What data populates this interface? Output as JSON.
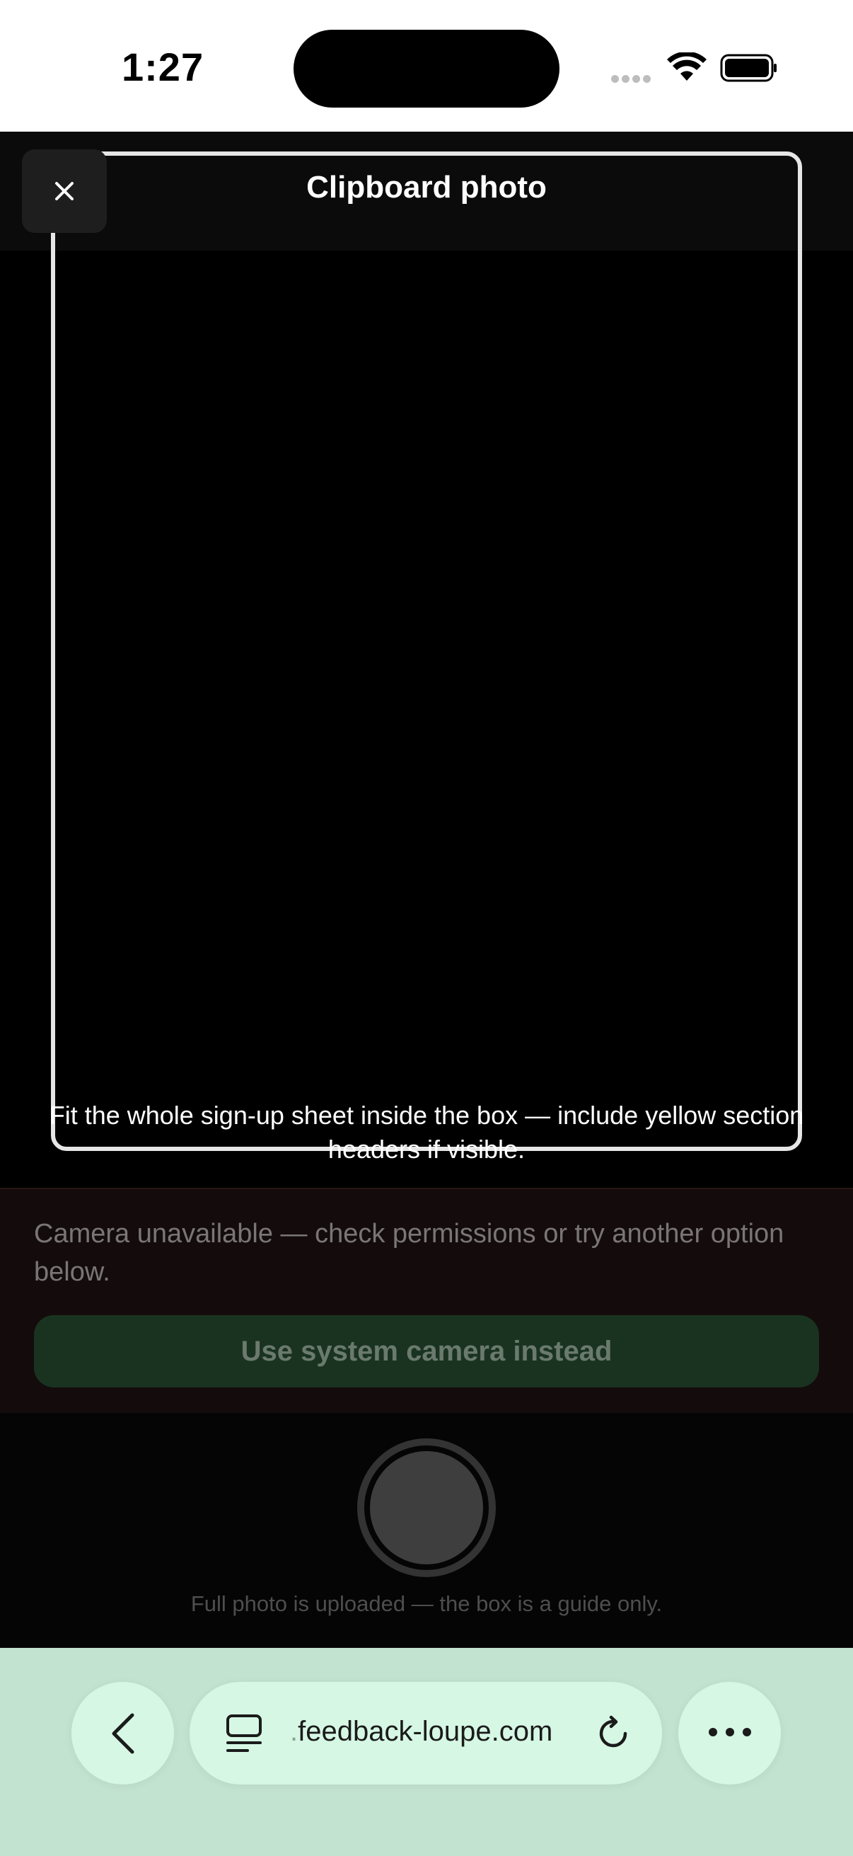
{
  "status_bar": {
    "time": "1:27"
  },
  "header": {
    "title": "Clipboard photo",
    "close_icon": "close-icon"
  },
  "guide": {
    "hint": "Fit the whole sign-up sheet inside the box — include yellow section headers if visible."
  },
  "error": {
    "message": "Camera unavailable — check permissions or try another option below.",
    "system_camera_label": "Use system camera instead"
  },
  "capture": {
    "note": "Full photo is uploaded — the box is a guide only."
  },
  "browser": {
    "url_prefix": ".",
    "url_main": "feedback-loupe.com",
    "back_icon": "chevron-left-icon",
    "tabs_icon": "tabs-icon",
    "reload_icon": "reload-icon",
    "more_icon": "more-icon"
  },
  "colors": {
    "accent_green": "#1a3320",
    "browser_bg": "#c3e3d1",
    "browser_pill": "#d6f7e4",
    "error_bg": "#140c0c"
  }
}
